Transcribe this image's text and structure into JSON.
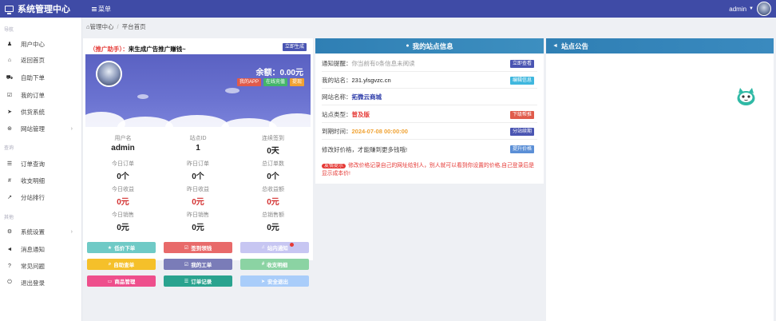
{
  "app": {
    "title": "系统管理中心",
    "menu_label": "菜单"
  },
  "user": {
    "name": "admin"
  },
  "sidebar": {
    "sections": [
      {
        "title": "导航",
        "items": [
          {
            "icon": "user-icon",
            "label": "用户中心",
            "has_chevron": false
          },
          {
            "icon": "home-icon",
            "label": "返回首页",
            "has_chevron": false
          },
          {
            "icon": "cart-icon",
            "label": "自助下单",
            "has_chevron": false
          },
          {
            "icon": "check-square-icon",
            "label": "我的订单",
            "has_chevron": false
          },
          {
            "icon": "send-icon",
            "label": "供货系统",
            "has_chevron": false
          },
          {
            "icon": "globe-icon",
            "label": "网站管理",
            "has_chevron": true
          }
        ]
      },
      {
        "title": "查询",
        "items": [
          {
            "icon": "list-icon",
            "label": "订单查询",
            "has_chevron": false
          },
          {
            "icon": "hash-icon",
            "label": "收支明细",
            "has_chevron": false
          },
          {
            "icon": "chart-icon",
            "label": "分站排行",
            "has_chevron": false
          }
        ]
      },
      {
        "title": "其他",
        "items": [
          {
            "icon": "gear-icon",
            "label": "系统设置",
            "has_chevron": true
          },
          {
            "icon": "bullhorn-icon",
            "label": "消息通知",
            "has_chevron": false
          },
          {
            "icon": "question-icon",
            "label": "常见问题",
            "has_chevron": false
          },
          {
            "icon": "power-icon",
            "label": "退出登录",
            "has_chevron": false
          }
        ]
      }
    ]
  },
  "breadcrumb": {
    "root": "管理中心",
    "separator": "/",
    "current": "平台首页"
  },
  "account": {
    "promo_prefix": "（推广助手）：",
    "promo_text": "来生成广告推广赚钱~",
    "generate_button": "立即生成",
    "balance_label": "余额：",
    "balance_value": "0.00元",
    "badges": [
      {
        "label": "我的APP",
        "color": "#e05b4b"
      },
      {
        "label": "在线充值",
        "color": "#43b56a"
      },
      {
        "label": "提现",
        "color": "#f0a232"
      }
    ],
    "stats": [
      {
        "label": "用户名",
        "value": "admin",
        "red": false
      },
      {
        "label": "站点ID",
        "value": "1",
        "red": false
      },
      {
        "label": "连续签到",
        "value": "0天",
        "red": false
      },
      {
        "label": "今日订单",
        "value": "0个",
        "red": false
      },
      {
        "label": "昨日订单",
        "value": "0个",
        "red": false
      },
      {
        "label": "总订单数",
        "value": "0个",
        "red": false
      },
      {
        "label": "今日收益",
        "value": "0元",
        "red": true
      },
      {
        "label": "昨日收益",
        "value": "0元",
        "red": true
      },
      {
        "label": "总收益额",
        "value": "0元",
        "red": true
      },
      {
        "label": "今日销售",
        "value": "0元",
        "red": false
      },
      {
        "label": "昨日销售",
        "value": "0元",
        "red": false
      },
      {
        "label": "总销售额",
        "value": "0元",
        "red": false
      }
    ],
    "actions": [
      {
        "icon": "cart-icon",
        "glyph": "★",
        "label": "低价下单",
        "color": "#6fcac6"
      },
      {
        "icon": "check-square-icon",
        "glyph": "☑",
        "label": "签到领钱",
        "color": "#e86a6a"
      },
      {
        "icon": "bullhorn-icon",
        "glyph": "♫",
        "label": "站内通知",
        "color": "#c7c6f2",
        "dot": true
      },
      {
        "icon": "search-icon",
        "glyph": "⌕",
        "label": "自助查单",
        "color": "#f5c02a"
      },
      {
        "icon": "check-square-icon",
        "glyph": "☑",
        "label": "我的工单",
        "color": "#7a7cb8"
      },
      {
        "icon": "hash-icon",
        "glyph": "#",
        "label": "收支明细",
        "color": "#8bd3a3"
      },
      {
        "icon": "card-icon",
        "glyph": "▭",
        "label": "商品管理",
        "color": "#ee4f8c"
      },
      {
        "icon": "list-icon",
        "glyph": "☰",
        "label": "订单记录",
        "color": "#2aa38f"
      },
      {
        "icon": "send-icon",
        "glyph": "➤",
        "label": "安全退出",
        "color": "#a9cdfa"
      }
    ]
  },
  "site_info": {
    "title": "我的站点信息",
    "notice_label": "通知提醒：",
    "notice_value": "你当前有0条信息未阅读",
    "notice_button": "立即查看",
    "domain_label": "我的站名：",
    "domain_value": "231.ylsgvzc.cn",
    "domain_button": "编辑信息",
    "name_label": "网站名称：",
    "name_value": "拓微云商城",
    "type_label": "站点类型：",
    "type_value": "普及版",
    "type_button": "下级帮推",
    "expire_label": "到期时间：",
    "expire_value": "2024-07-08 00:00:00",
    "expire_button": "分站续期",
    "price_text": "修改好价格，才能赚到更多钱哦!",
    "price_button": "提升价格",
    "warn_tag": "友情提示",
    "warn_text": "修改价格记录自己的网址给别人，别人就可以看到你设置的价格,自己登录后是显示成本价!"
  },
  "announcement": {
    "title": "站点公告"
  },
  "colors": {
    "topbar": "#3f4ba6",
    "panel_header": "#2f7fb4",
    "danger": "#e53935"
  }
}
